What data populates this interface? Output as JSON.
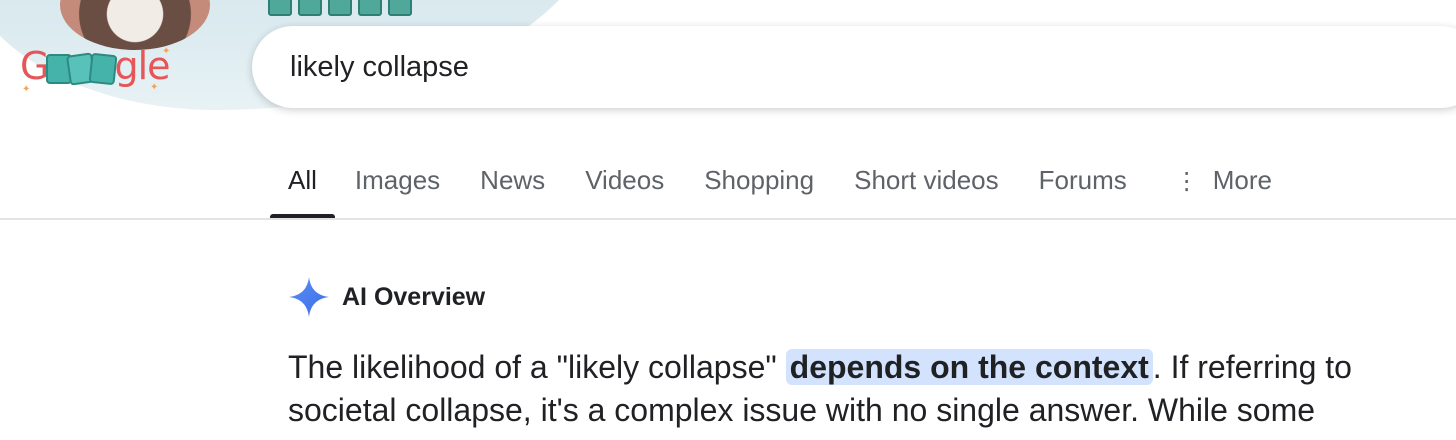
{
  "search": {
    "query": "likely collapse"
  },
  "logo": {
    "text_first": "G",
    "text_rest": "gle"
  },
  "tabs": [
    {
      "label": "All",
      "active": true
    },
    {
      "label": "Images",
      "active": false
    },
    {
      "label": "News",
      "active": false
    },
    {
      "label": "Videos",
      "active": false
    },
    {
      "label": "Shopping",
      "active": false
    },
    {
      "label": "Short videos",
      "active": false
    },
    {
      "label": "Forums",
      "active": false
    },
    {
      "label": "More",
      "active": false,
      "icon": "more-vert-icon"
    }
  ],
  "ai_overview": {
    "title": "AI Overview",
    "icon": "gemini-sparkle-icon",
    "text_before": "The likelihood of a \"likely collapse\" ",
    "highlight": "depends on the context",
    "text_after": ". If referring to societal collapse, it's a complex issue with no single answer. While some"
  },
  "colors": {
    "highlight_bg": "#d3e3fd",
    "sparkle_blue": "#4285f4",
    "logo_red": "#e4565a",
    "logo_teal": "#45b3aa"
  }
}
